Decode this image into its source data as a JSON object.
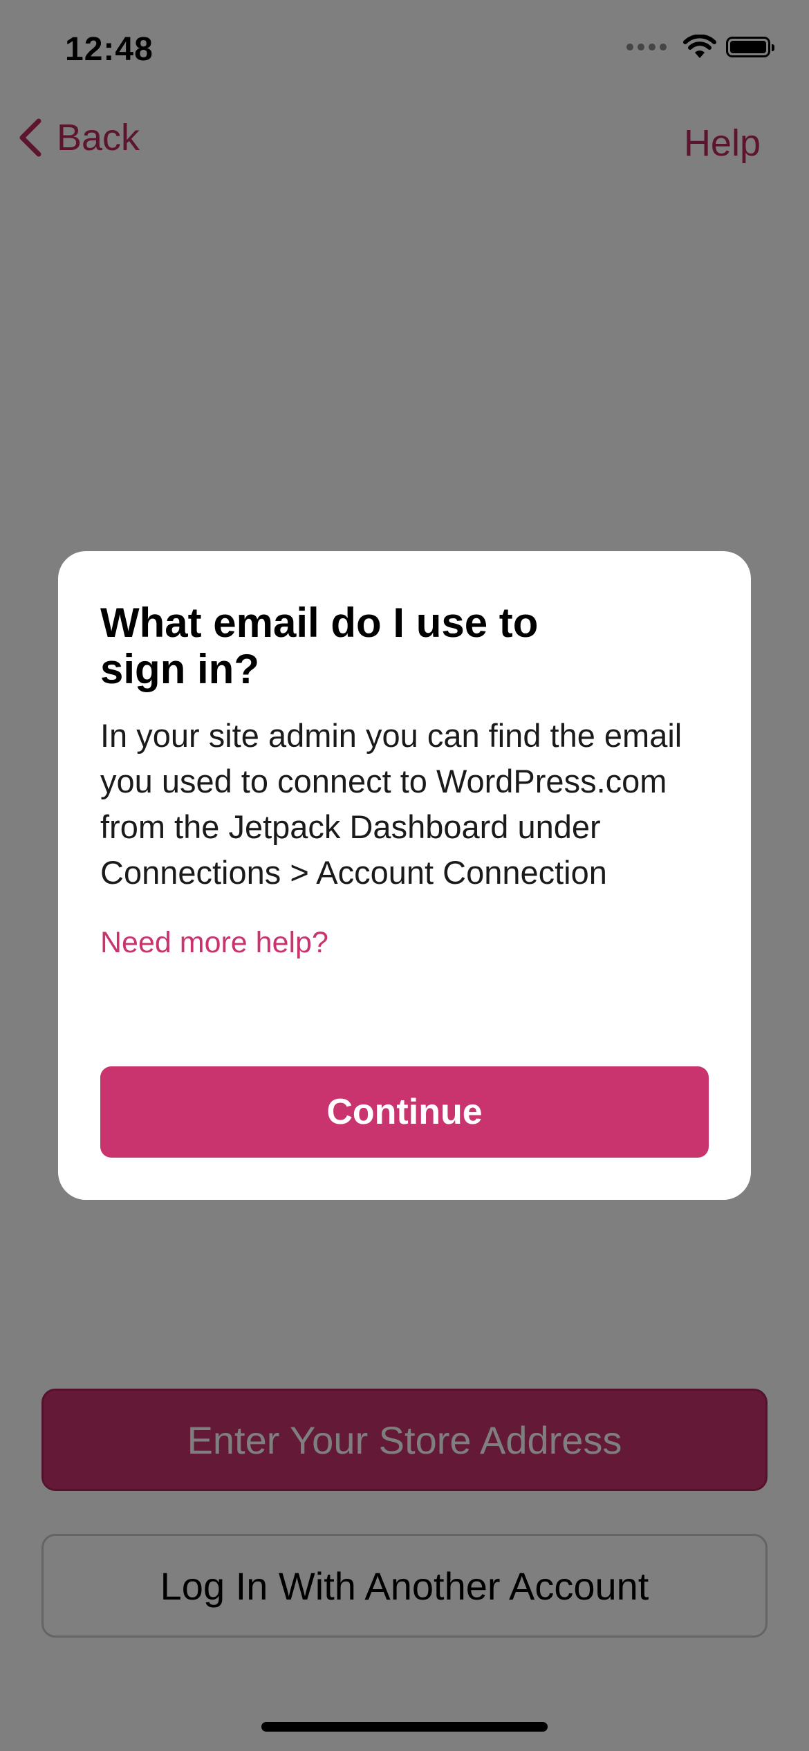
{
  "status_bar": {
    "time": "12:48",
    "icons": [
      "cellular-dots-icon",
      "wifi-icon",
      "battery-icon"
    ]
  },
  "nav": {
    "back_label": "Back",
    "help_label": "Help",
    "back_icon": "chevron-left-icon"
  },
  "actions": {
    "store_address_label": "Enter Your Store Address",
    "another_account_label": "Log In With Another Account"
  },
  "dialog": {
    "title": "What email do I use to sign in?",
    "body": "In your site admin you can find the email you used to connect to WordPress.com from the Jetpack Dashboard under Connections > Account Connection",
    "help_link": "Need more help?",
    "continue_label": "Continue"
  },
  "colors": {
    "accent": "#c9346e",
    "overlay": "rgba(0,0,0,0.5)"
  }
}
